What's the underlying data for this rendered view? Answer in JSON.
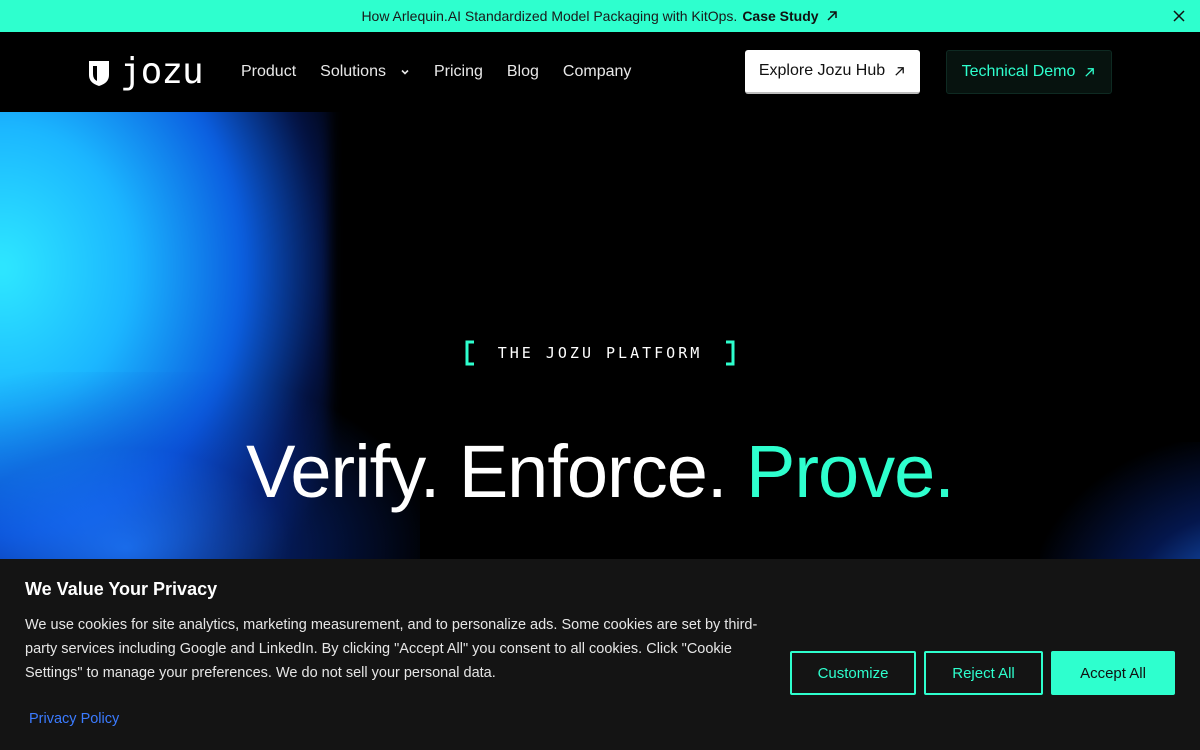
{
  "announcement": {
    "text": "How Arlequin.AI Standardized Model Packaging with KitOps.",
    "link_label": "Case Study"
  },
  "nav": {
    "logo_text": "jozu",
    "links": [
      "Product",
      "Solutions",
      "Pricing",
      "Blog",
      "Company"
    ],
    "hub_button": "Explore Jozu Hub",
    "demo_button": "Technical Demo"
  },
  "hero": {
    "eyebrow": "THE JOZU PLATFORM",
    "headline_white": "Verify. Enforce.",
    "headline_accent": "Prove."
  },
  "cookie": {
    "title": "We Value Your Privacy",
    "body": "We use cookies for site analytics, marketing measurement, and to personalize ads. Some cookies are set by third-party services including Google and LinkedIn. By clicking \"Accept All\" you consent to all cookies. Click \"Cookie Settings\" to manage your preferences. We do not sell your personal data.",
    "privacy_link": "Privacy Policy",
    "customize": "Customize",
    "reject": "Reject All",
    "accept": "Accept All"
  },
  "colors": {
    "accent": "#2effce",
    "background": "#000000",
    "cookie_bg": "#141414",
    "link_blue": "#3b7bff"
  }
}
